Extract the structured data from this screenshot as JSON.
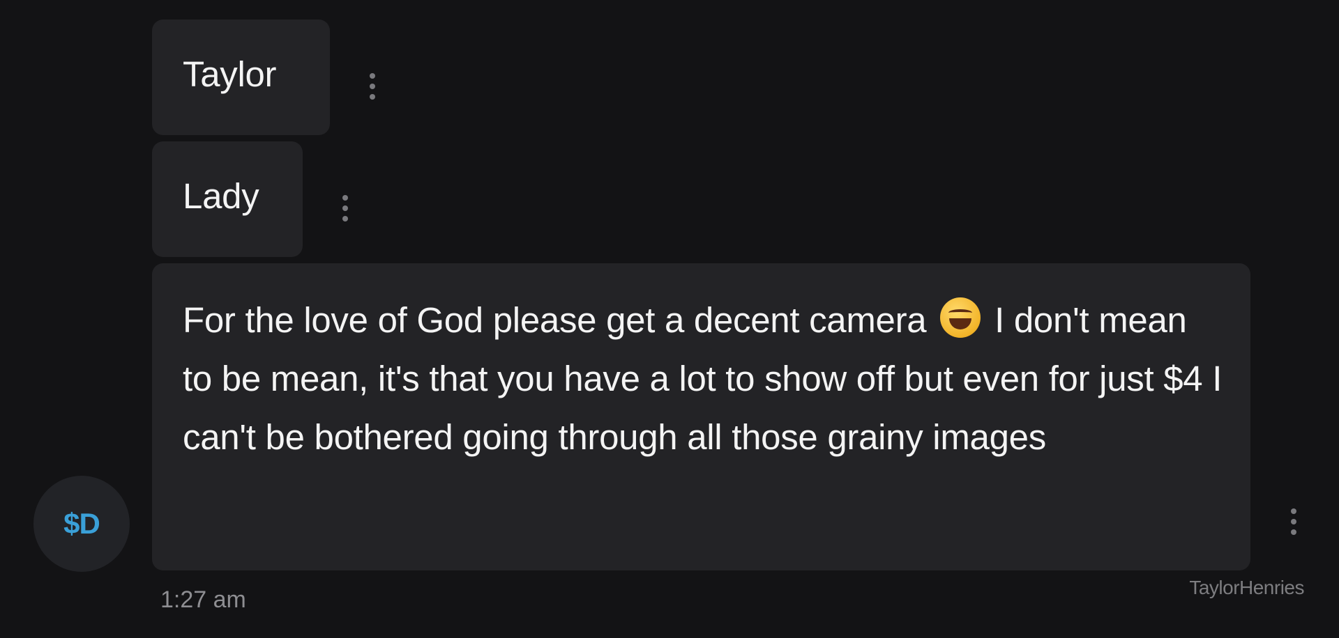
{
  "messages": [
    {
      "text": "Taylor"
    },
    {
      "text": "Lady"
    },
    {
      "text_before_emoji": "For the love of God please get a decent camera",
      "emoji": "face-with-tears-of-joy",
      "text_after_emoji": "I don't mean to be mean, it's that you have a lot to show off but even for just $4 I can't be bothered going through all those grainy images"
    }
  ],
  "sender": {
    "avatar_initials": "$D",
    "avatar_color": "#3aa0d8"
  },
  "timestamp": "1:27 am",
  "watermark": "TaylorHenries",
  "colors": {
    "background": "#131315",
    "bubble": "#232326",
    "text": "#f4f4f4",
    "muted": "#8e8e92"
  }
}
